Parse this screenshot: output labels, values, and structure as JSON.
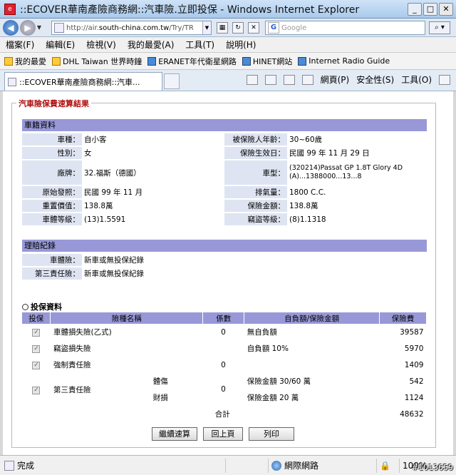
{
  "window": {
    "title": "::ECOVER華南產險商務網::汽車險.立即投保 - Windows Internet Explorer"
  },
  "address": {
    "url_prefix": "http://air.",
    "url_domain": "south-china.com.tw",
    "url_rest": "/Try/TR"
  },
  "search": {
    "placeholder": "Google"
  },
  "menu": [
    "檔案(F)",
    "編輯(E)",
    "檢視(V)",
    "我的最愛(A)",
    "工具(T)",
    "說明(H)"
  ],
  "favorites": {
    "label": "我的最愛",
    "items": [
      "DHL Taiwan 世界時鐘",
      "ERANET年代衛星網路",
      "HINET網站",
      "Internet Radio Guide"
    ]
  },
  "tab": {
    "label": "::ECOVER華南產險商務網::汽車..."
  },
  "commands": {
    "page": "網頁(P)",
    "safety": "安全性(S)",
    "tools": "工具(O)"
  },
  "page": {
    "legend": "汽車險保費速算結果",
    "vehicle_header": "車籍資料",
    "vehicle": [
      {
        "l1": "車種：",
        "v1": "自小客",
        "l2": "被保險人年齡：",
        "v2": "30~60歲"
      },
      {
        "l1": "性別：",
        "v1": "女",
        "l2": "保險生效日：",
        "v2": "民國 99 年 11 月 29 日"
      },
      {
        "l1": "廠牌：",
        "v1": "32.福斯（德國）",
        "l2": "車型：",
        "v2": "(320214)Passat GP 1.8T Glory 4D (A)...1388000...13...8"
      },
      {
        "l1": "原始發照：",
        "v1": "民國 99 年 11 月",
        "l2": "排氣量：",
        "v2": "1800 C.C."
      },
      {
        "l1": "重置價值：",
        "v1": "138.8萬",
        "l2": "保險金額：",
        "v2": "138.8萬"
      },
      {
        "l1": "車體等級：",
        "v1": "(13)1.5591",
        "l2": "竊盜等級：",
        "v2": "(8)1.1318"
      }
    ],
    "claims_header": "理賠紀錄",
    "claims": [
      {
        "l": "車體險：",
        "v": "新車或無投保紀錄"
      },
      {
        "l": "第三責任險：",
        "v": "新車或無投保紀錄"
      }
    ],
    "insurance_title": "投保資料",
    "columns": [
      "投保",
      "險種名稱",
      "係數",
      "自負額/保險金額",
      "保險費"
    ],
    "rows": [
      {
        "name": "車體損失險(乙式)",
        "sub": "",
        "coef": "0",
        "deduct": "無自負額",
        "premium": "39587"
      },
      {
        "name": "竊盜損失險",
        "sub": "",
        "coef": "",
        "deduct": "自負額 10%",
        "premium": "5970"
      },
      {
        "name": "強制責任險",
        "sub": "",
        "coef": "0",
        "deduct": "",
        "premium": "1409"
      }
    ],
    "third_party": {
      "name": "第三責任險",
      "coef": "0",
      "sub1": "體傷",
      "deduct1": "保險金額 30/60 萬",
      "premium1": "542",
      "sub2": "財損",
      "deduct2": "保險金額 20 萬",
      "premium2": "1124"
    },
    "total_label": "合計",
    "total": "48632",
    "buttons": {
      "continue": "繼續速算",
      "back": "回上頁",
      "print": "列印"
    }
  },
  "status": {
    "text": "完成",
    "zone": "網際網路",
    "zoom": "100%"
  },
  "watermark": "#1013659"
}
